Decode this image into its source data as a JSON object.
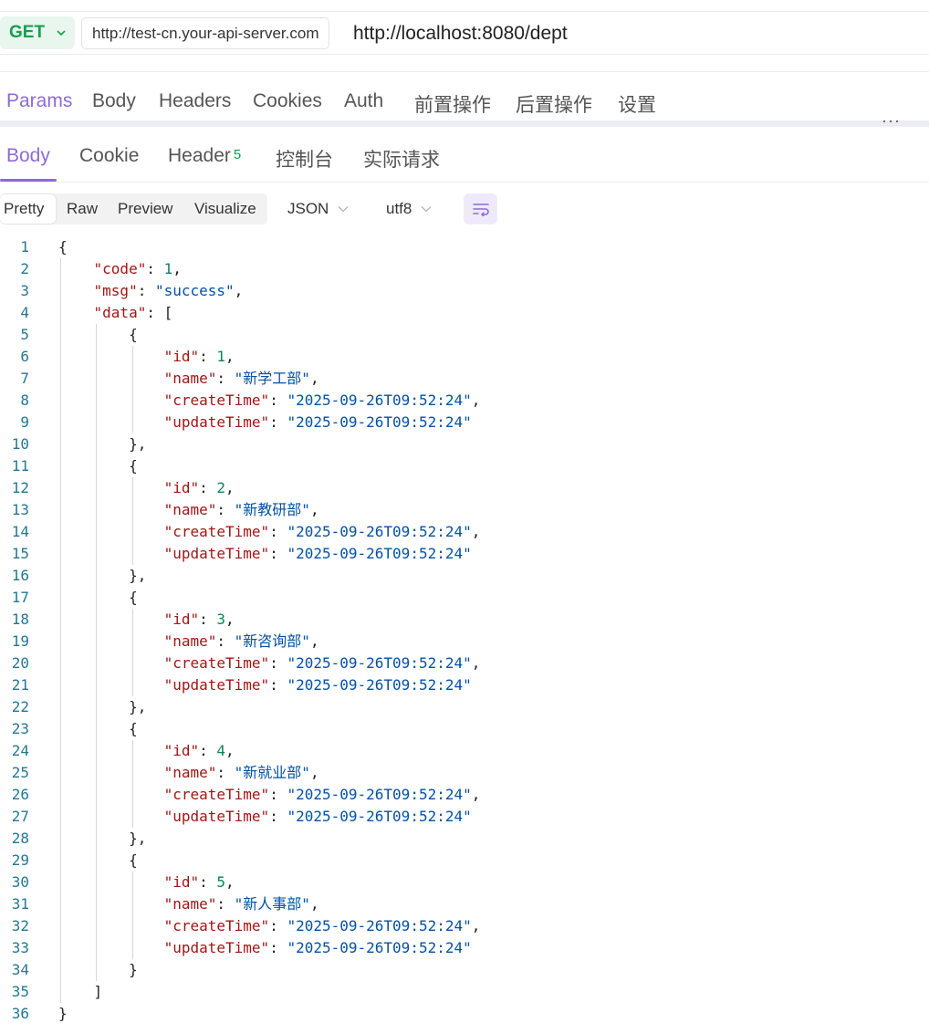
{
  "request": {
    "method": "GET",
    "base_url": "http://test-cn.your-api-server.com",
    "path": "http://localhost:8080/dept"
  },
  "request_tabs": [
    {
      "label": "Params",
      "active": true
    },
    {
      "label": "Body"
    },
    {
      "label": "Headers"
    },
    {
      "label": "Cookies"
    },
    {
      "label": "Auth"
    },
    {
      "label": "前置操作"
    },
    {
      "label": "后置操作"
    },
    {
      "label": "设置"
    }
  ],
  "more_label": "···",
  "response_tabs": [
    {
      "label": "Body",
      "active": true
    },
    {
      "label": "Cookie"
    },
    {
      "label": "Header",
      "badge": "5"
    },
    {
      "label": "控制台"
    },
    {
      "label": "实际请求"
    }
  ],
  "view_modes": [
    "Pretty",
    "Raw",
    "Preview",
    "Visualize"
  ],
  "format_select": "JSON",
  "encoding_select": "utf8",
  "response": {
    "code": 1,
    "msg": "success",
    "data": [
      {
        "id": 1,
        "name": "新学工部",
        "createTime": "2025-09-26T09:52:24",
        "updateTime": "2025-09-26T09:52:24"
      },
      {
        "id": 2,
        "name": "新教研部",
        "createTime": "2025-09-26T09:52:24",
        "updateTime": "2025-09-26T09:52:24"
      },
      {
        "id": 3,
        "name": "新咨询部",
        "createTime": "2025-09-26T09:52:24",
        "updateTime": "2025-09-26T09:52:24"
      },
      {
        "id": 4,
        "name": "新就业部",
        "createTime": "2025-09-26T09:52:24",
        "updateTime": "2025-09-26T09:52:24"
      },
      {
        "id": 5,
        "name": "新人事部",
        "createTime": "2025-09-26T09:52:24",
        "updateTime": "2025-09-26T09:52:24"
      }
    ]
  },
  "colors": {
    "accent": "#8e6ad8",
    "method_green": "#12a150",
    "json_key": "#a31515",
    "json_string": "#0451a5",
    "json_number": "#098658",
    "line_number": "#237893"
  }
}
